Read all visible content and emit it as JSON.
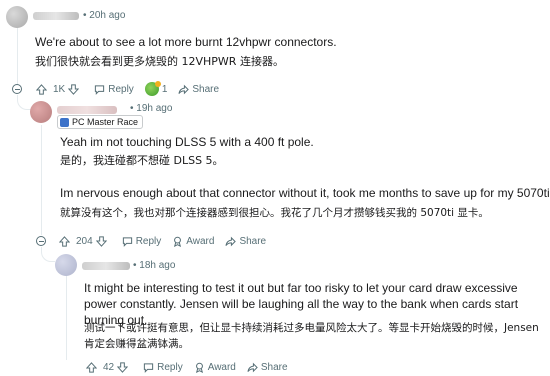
{
  "comment1": {
    "timestamp": "20h ago",
    "body_en": "We're about to see a lot more burnt 12vhpwr connectors.",
    "body_zh": "我们很快就会看到更多烧毁的 12VHPWR 连接器。",
    "votes": "1K",
    "reply_label": "Reply",
    "award_count": "1",
    "share_label": "Share"
  },
  "comment2": {
    "timestamp": "19h ago",
    "flair": "PC Master Race",
    "body_en_1": "Yeah im not touching DLSS 5 with a 400 ft pole.",
    "body_zh_1": "是的，我连碰都不想碰 DLSS 5。",
    "body_en_2": "Im nervous enough about that connector without it, took me months to save up for my 5070ti",
    "body_zh_2": "就算没有这个，我也对那个连接器感到很担心。我花了几个月才攒够钱买我的 5070ti 显卡。",
    "votes": "204",
    "reply_label": "Reply",
    "award_label": "Award",
    "share_label": "Share"
  },
  "comment3": {
    "timestamp": "18h ago",
    "body_en": "It might be interesting to test it out but far too risky to let your card draw excessive power constantly. Jensen will be laughing all the way to the bank when cards start burning out.",
    "body_zh": "测试一下或许挺有意思，但让显卡持续消耗过多电量风险太大了。等显卡开始烧毁的时候，Jensen 肯定会赚得盆满钵满。",
    "votes": "42",
    "reply_label": "Reply",
    "award_label": "Award",
    "share_label": "Share"
  },
  "colors": {
    "meta_text": "#576f76",
    "flair_icon": "#3c72c9",
    "thread_line": "#e5ebee"
  }
}
